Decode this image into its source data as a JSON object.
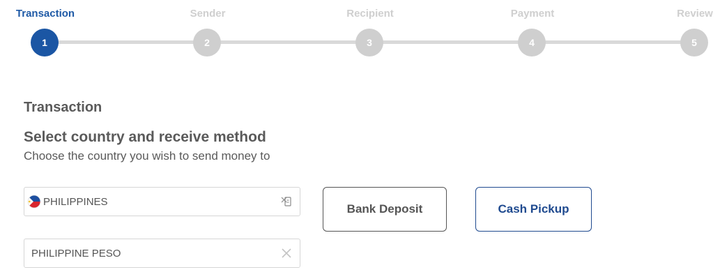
{
  "stepper": {
    "steps": [
      {
        "label": "Transaction",
        "number": "1",
        "active": true
      },
      {
        "label": "Sender",
        "number": "2",
        "active": false
      },
      {
        "label": "Recipient",
        "number": "3",
        "active": false
      },
      {
        "label": "Payment",
        "number": "4",
        "active": false
      },
      {
        "label": "Review",
        "number": "5",
        "active": false
      }
    ]
  },
  "main": {
    "section_title": "Transaction",
    "subtitle": "Select country and receive method",
    "helper_text": "Choose the country you wish to send money to"
  },
  "country_field": {
    "value": "PHILIPPINES",
    "flag_icon": "philippines-flag-icon",
    "action_icon": "dropdown-toggle-icon"
  },
  "currency_field": {
    "value": "PHILIPPINE PESO",
    "action_icon": "clear-icon"
  },
  "methods": {
    "bank_deposit": "Bank Deposit",
    "cash_pickup": "Cash Pickup"
  },
  "colors": {
    "active_step": "#1b56a4",
    "inactive_step": "#cfcfcf",
    "cash_pickup_accent": "#1f4a8f",
    "text": "#555555"
  }
}
